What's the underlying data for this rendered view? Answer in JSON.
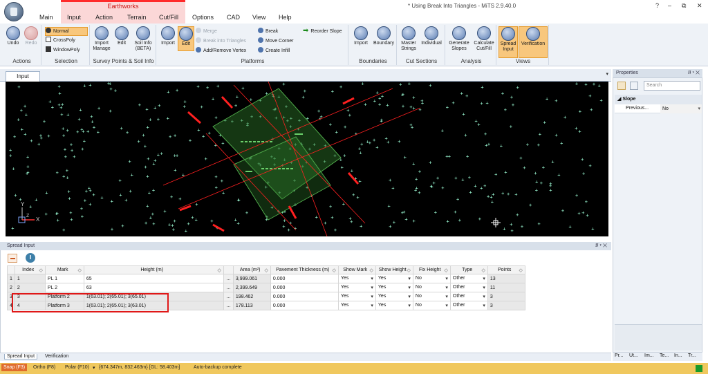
{
  "window": {
    "title": "* Using Break Into Triangles - MiTS 2.9.40.0",
    "help": "?",
    "minimize": "–",
    "restore": "⧉",
    "close": "✕"
  },
  "menu": {
    "context_label": "Earthworks",
    "tabs": [
      "Main",
      "Input",
      "Action",
      "Terrain",
      "Cut/Fill",
      "Options",
      "CAD",
      "View",
      "Help"
    ]
  },
  "ribbon": {
    "actions": {
      "label": "Actions",
      "undo": "Undo",
      "redo": "Redo"
    },
    "selection": {
      "label": "Selection",
      "normal": "Normal",
      "crosspoly": "CrossPoly",
      "windowpoly": "WindowPoly"
    },
    "survey": {
      "label": "Survey Points & Soil Info",
      "import_manage_1": "Import",
      "import_manage_2": "Manage",
      "edit": "Edit",
      "soil_1": "Soil Info",
      "soil_2": "(BETA)"
    },
    "platforms": {
      "label": "Platforms",
      "import": "Import",
      "edit": "Edit",
      "merge": "Merge",
      "break_into_triangles": "Break into Triangles",
      "add_remove_vertex": "Add/Remove Vertex",
      "break": "Break",
      "move_corner": "Move Corner",
      "create_infill": "Create Infill",
      "reorder_slope": "Reorder Slope"
    },
    "boundaries": {
      "label": "Boundaries",
      "import": "Import",
      "boundary": "Boundary"
    },
    "cut_sections": {
      "label": "Cut Sections",
      "master_1": "Master",
      "master_2": "Strings",
      "individual": "Individual"
    },
    "analysis": {
      "label": "Analysis",
      "gen_1": "Generate",
      "gen_2": "Slopes",
      "calc_1": "Calculate",
      "calc_2": "Cut/Fill"
    },
    "views": {
      "label": "Views",
      "spread_1": "Spread",
      "spread_2": "Input",
      "verification": "Verification"
    }
  },
  "input_panel": {
    "tab": "Input",
    "panel_menu": "▾"
  },
  "canvas": {
    "background": "#000000",
    "point_color": "#9fffd8",
    "platform_color": "#2f7a2a",
    "line_color": "#ff2020",
    "axis_y": "Y",
    "axis_x": "X",
    "axis_z": "Z"
  },
  "spread": {
    "title": "Spread Input",
    "pins": "⭿ ▾ ✕",
    "util_icon": "‖",
    "columns": [
      "Index",
      "Mark",
      "Height (m)",
      "",
      "Area (m²)",
      "Pavement Thickness (m)",
      "Show Mark",
      "Show Height",
      "Fix Height",
      "Type",
      "Points"
    ],
    "sorter": "◇",
    "rows": [
      {
        "rownum": "1",
        "index": "1",
        "mark": "PL 1",
        "height": "65",
        "ellipsis": "...",
        "area": "3,999.061",
        "pavement": "0.000",
        "show_mark": "Yes",
        "show_height": "Yes",
        "fix_height": "No",
        "type": "Other",
        "points": "13"
      },
      {
        "rownum": "2",
        "index": "2",
        "mark": "PL 2",
        "height": "63",
        "ellipsis": "...",
        "area": "2,399.649",
        "pavement": "0.000",
        "show_mark": "Yes",
        "show_height": "Yes",
        "fix_height": "No",
        "type": "Other",
        "points": "11"
      },
      {
        "rownum": "3",
        "index": "3",
        "mark": "Platform 2",
        "height": "1(63.01); 2(65.01); 3(65.01)",
        "ellipsis": "...",
        "area": "198.462",
        "pavement": "0.000",
        "show_mark": "Yes",
        "show_height": "Yes",
        "fix_height": "No",
        "type": "Other",
        "points": "3"
      },
      {
        "rownum": "4",
        "index": "4",
        "mark": "Platform 3",
        "height": "1(63.01); 2(65.01); 3(63.01)",
        "ellipsis": "...",
        "area": "178.113",
        "pavement": "0.000",
        "show_mark": "Yes",
        "show_height": "Yes",
        "fix_height": "No",
        "type": "Other",
        "points": "3"
      }
    ],
    "bottom_tabs": [
      "Spread Input",
      "Verification"
    ]
  },
  "properties": {
    "title": "Properties",
    "pins": "⭿ ▾ ✕",
    "search_placeholder": "Search",
    "category": "Slope",
    "row_name": "Previous...",
    "row_value": "No",
    "tabs": [
      "Pr...",
      "Ut...",
      "Im...",
      "Te...",
      "In...",
      "Tr..."
    ]
  },
  "status": {
    "snap": "Snap (F3)",
    "ortho": "Ortho (F8)",
    "polar": "Polar (F10)",
    "polar_dd": "▾",
    "coords": "{674.347m, 832.463m} [GL: 58.403m]",
    "message": "Auto-backup complete"
  }
}
